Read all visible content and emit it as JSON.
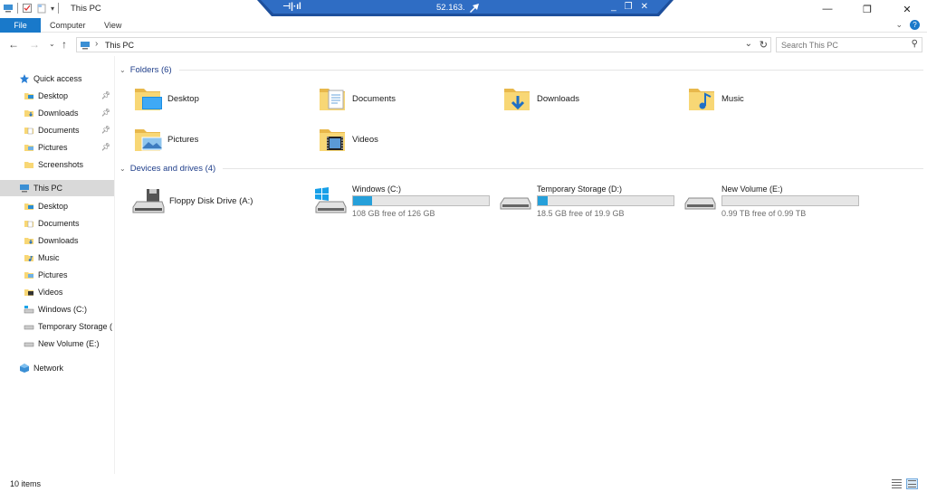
{
  "window": {
    "title": "This PC",
    "remote_ip": "52.163.",
    "remote_signal": "⊣|·ıl"
  },
  "ribbon": {
    "tabs": [
      "File",
      "Computer",
      "View"
    ]
  },
  "address": {
    "path": "This PC",
    "search_placeholder": "Search This PC"
  },
  "sidebar": {
    "quick_access": "Quick access",
    "quick_items": [
      {
        "label": "Desktop",
        "pinned": true
      },
      {
        "label": "Downloads",
        "pinned": true
      },
      {
        "label": "Documents",
        "pinned": true
      },
      {
        "label": "Pictures",
        "pinned": true
      },
      {
        "label": "Screenshots",
        "pinned": false
      }
    ],
    "this_pc": "This PC",
    "pc_items": [
      "Desktop",
      "Documents",
      "Downloads",
      "Music",
      "Pictures",
      "Videos",
      "Windows (C:)",
      "Temporary Storage (",
      "New Volume (E:)"
    ],
    "network": "Network"
  },
  "folders": {
    "header": "Folders (6)",
    "items": [
      "Desktop",
      "Documents",
      "Downloads",
      "Music",
      "Pictures",
      "Videos"
    ]
  },
  "drives": {
    "header": "Devices and drives (4)",
    "floppy": "Floppy Disk Drive (A:)",
    "items": [
      {
        "name": "Windows (C:)",
        "free": "108 GB free of 126 GB",
        "used_fraction": 0.14
      },
      {
        "name": "Temporary Storage (D:)",
        "free": "18.5 GB free of 19.9 GB",
        "used_fraction": 0.07
      },
      {
        "name": "New Volume (E:)",
        "free": "0.99 TB free of 0.99 TB",
        "used_fraction": 0.0
      }
    ]
  },
  "status": {
    "items_count": "10 items"
  },
  "colors": {
    "accent": "#1979ca",
    "drive_fill": "#26a0da",
    "group_header": "#1f3e8a",
    "folder": "#f8d775"
  }
}
